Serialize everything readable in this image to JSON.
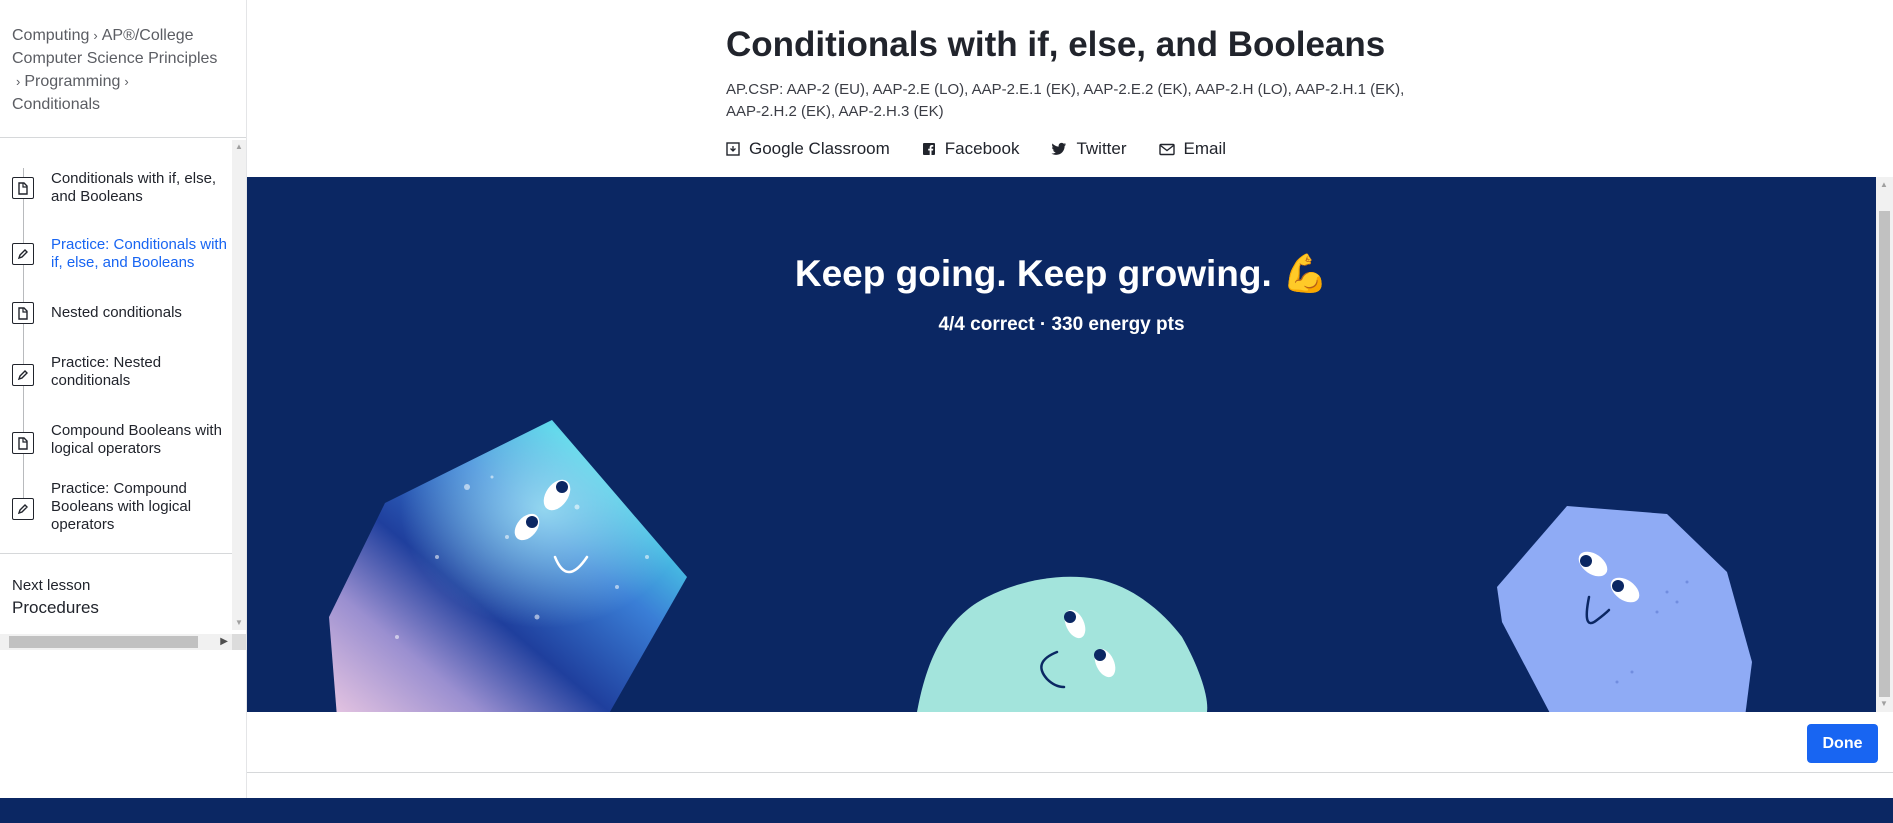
{
  "breadcrumb": {
    "items": [
      "Computing",
      "AP®︎/College Computer Science Principles",
      "Programming",
      "Conditionals"
    ]
  },
  "sidebar": {
    "items": [
      {
        "label": "Conditionals with if, else, and Booleans",
        "type": "article",
        "icon": "article-icon",
        "active": false
      },
      {
        "label": "Practice: Conditionals with if, else, and Booleans",
        "type": "exercise",
        "icon": "pencil-icon",
        "active": true
      },
      {
        "label": "Nested conditionals",
        "type": "article",
        "icon": "article-icon",
        "active": false
      },
      {
        "label": "Practice: Nested conditionals",
        "type": "exercise",
        "icon": "pencil-icon",
        "active": false
      },
      {
        "label": "Compound Booleans with logical operators",
        "type": "article",
        "icon": "article-icon",
        "active": false
      },
      {
        "label": "Practice: Compound Booleans with logical operators",
        "type": "exercise",
        "icon": "pencil-icon",
        "active": false
      }
    ],
    "next_lesson_label": "Next lesson",
    "next_lesson_title": "Procedures"
  },
  "header": {
    "title": "Conditionals with if, else, and Booleans",
    "standards": "AP.CSP: AAP‑2 (EU), AAP‑2.E (LO), AAP‑2.E.1 (EK), AAP‑2.E.2 (EK), AAP‑2.H (LO), AAP‑2.H.1 (EK), AAP‑2.H.2 (EK), AAP‑2.H.3 (EK)",
    "share": [
      {
        "label": "Google Classroom",
        "icon": "google-classroom-icon"
      },
      {
        "label": "Facebook",
        "icon": "facebook-icon"
      },
      {
        "label": "Twitter",
        "icon": "twitter-icon"
      },
      {
        "label": "Email",
        "icon": "email-icon"
      }
    ]
  },
  "exercise": {
    "headline": "Keep going. Keep growing. 💪",
    "score": "4/4 correct · 330 energy pts",
    "background": "#0b2763",
    "characters": [
      "blue-galaxy-character",
      "mint-blob-character",
      "periwinkle-hexagon-character"
    ]
  },
  "footer": {
    "done_label": "Done",
    "accent": "#1865f2"
  }
}
